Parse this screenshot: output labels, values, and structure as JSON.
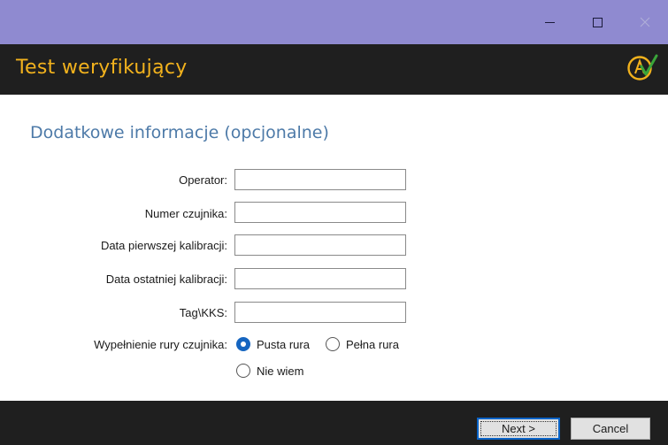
{
  "window": {
    "title": "Test weryfikujący",
    "controls": [
      "minimize",
      "maximize",
      "close"
    ]
  },
  "logo": {
    "icon": "app-logo-icon",
    "colors": {
      "ring": "#f2b21d",
      "check": "#3aa53a"
    }
  },
  "section": {
    "title": "Dodatkowe informacje (opcjonalne)"
  },
  "form": {
    "operator": {
      "label": "Operator:",
      "value": ""
    },
    "sensor_number": {
      "label": "Numer czujnika:",
      "value": ""
    },
    "first_calibration": {
      "label": "Data pierwszej kalibracji:",
      "value": ""
    },
    "last_calibration": {
      "label": "Data ostatniej kalibracji:",
      "value": ""
    },
    "tag_kks": {
      "label": "Tag\\KKS:",
      "value": ""
    },
    "pipe_fill": {
      "label": "Wypełnienie rury czujnika:",
      "options": [
        {
          "label": "Pusta rura",
          "selected": true
        },
        {
          "label": "Pełna rura",
          "selected": false
        },
        {
          "label": "Nie wiem",
          "selected": false
        }
      ]
    }
  },
  "footer": {
    "next_label": "Next >",
    "cancel_label": "Cancel"
  },
  "colors": {
    "titlebar": "#8f8ad0",
    "header": "#1f1f1f",
    "title_text": "#f2b21d",
    "section_text": "#4d7aa8",
    "radio_selected": "#1565c0"
  }
}
